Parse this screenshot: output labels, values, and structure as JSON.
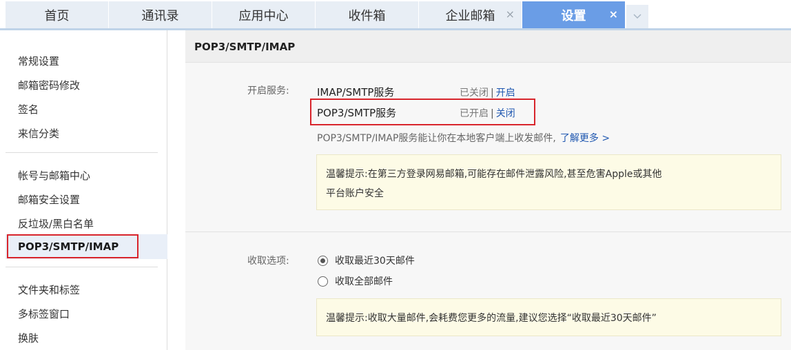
{
  "tabs": [
    {
      "label": "首页"
    },
    {
      "label": "通讯录"
    },
    {
      "label": "应用中心"
    },
    {
      "label": "收件箱"
    },
    {
      "label": "企业邮箱",
      "close": "×"
    },
    {
      "label": "设置",
      "close": "×"
    }
  ],
  "tab_more_icon": "chevron-down-icon",
  "sidebar": {
    "group1": [
      "常规设置",
      "邮箱密码修改",
      "签名",
      "来信分类"
    ],
    "group2": [
      "帐号与邮箱中心",
      "邮箱安全设置",
      "反垃圾/黑白名单",
      "POP3/SMTP/IMAP"
    ],
    "group3": [
      "文件夹和标签",
      "多标签窗口",
      "换肤"
    ],
    "active": "POP3/SMTP/IMAP"
  },
  "main": {
    "title": "POP3/SMTP/IMAP",
    "service_label": "开启服务:",
    "services": [
      {
        "name": "IMAP/SMTP服务",
        "status": "已关闭",
        "sep": "|",
        "action": "开启"
      },
      {
        "name": "POP3/SMTP服务",
        "status": "已开启",
        "sep": "|",
        "action": "关闭"
      }
    ],
    "description": "POP3/SMTP/IMAP服务能让你在本地客户端上收发邮件,",
    "learn_more": "了解更多 >",
    "notice1_line1": "温馨提示:在第三方登录网易邮箱,可能存在邮件泄露风险,甚至危害Apple或其他",
    "notice1_line2": "平台账户安全",
    "receive_label": "收取选项:",
    "receive_options": [
      {
        "label": "收取最近30天邮件",
        "selected": true
      },
      {
        "label": "收取全部邮件",
        "selected": false
      }
    ],
    "notice2": "温馨提示:收取大量邮件,会耗费您更多的流量,建议您选择“收取最近30天邮件”"
  },
  "colors": {
    "active_tab": "#6a9de6",
    "link": "#1f57b0",
    "highlight_border": "#d8242b",
    "notice_bg": "#fdfbe6"
  }
}
